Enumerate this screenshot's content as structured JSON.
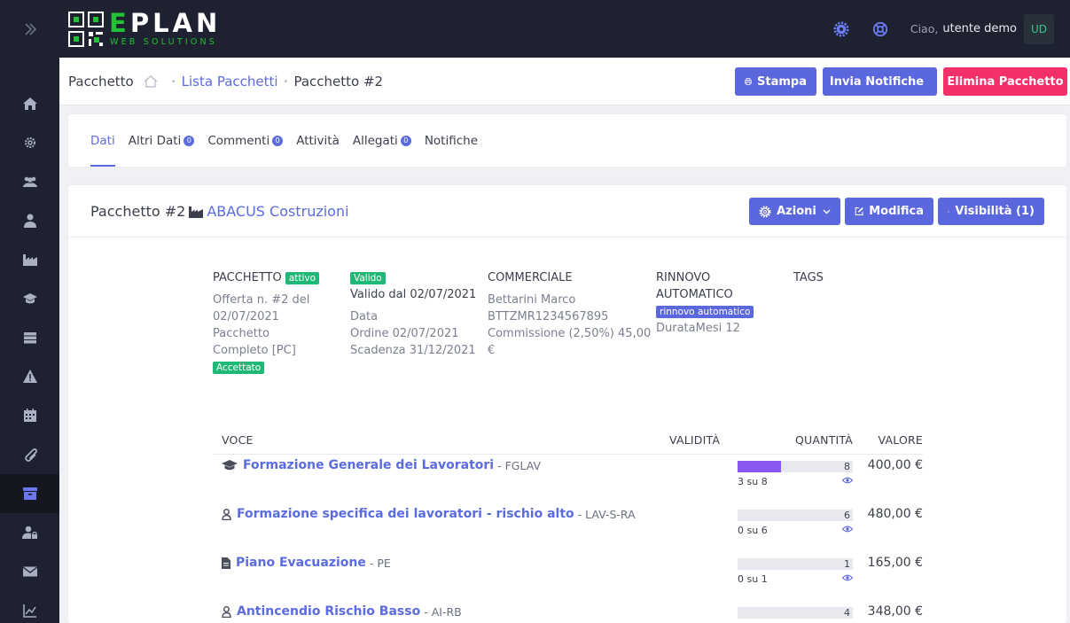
{
  "sidebar": {
    "toggle_icon": "double-chevron-right-icon",
    "items": [
      {
        "icon": "home-icon"
      },
      {
        "icon": "gear-icon"
      },
      {
        "icon": "users-icon"
      },
      {
        "icon": "user-tie-icon"
      },
      {
        "icon": "industry-icon"
      },
      {
        "icon": "graduation-cap-icon"
      },
      {
        "icon": "server-icon"
      },
      {
        "icon": "warning-icon"
      },
      {
        "icon": "calendar-icon"
      },
      {
        "icon": "paperclip-icon"
      },
      {
        "icon": "archive-icon",
        "active": true
      },
      {
        "icon": "user-lock-icon"
      },
      {
        "icon": "envelope-icon"
      },
      {
        "icon": "chart-icon"
      }
    ]
  },
  "topbar": {
    "logo_main": "EPLAN",
    "logo_sub": "WEB SOLUTIONS",
    "greeting": "Ciao,",
    "username": "utente demo",
    "avatar": "UD",
    "icons": [
      "settings-gear-icon",
      "support-lifebuoy-icon"
    ]
  },
  "header": {
    "title": "Pacchetto",
    "breadcrumb_link": "Lista Pacchetti",
    "breadcrumb_current": "Pacchetto #2",
    "btn_print": "Stampa",
    "btn_notify": "Invia Notifiche",
    "btn_delete": "Elimina Pacchetto"
  },
  "tabs": [
    {
      "label": "Dati",
      "active": true
    },
    {
      "label": "Altri Dati",
      "badge": "0"
    },
    {
      "label": "Commenti",
      "badge": "0"
    },
    {
      "label": "Attività"
    },
    {
      "label": "Allegati",
      "badge": "0"
    },
    {
      "label": "Notifiche"
    }
  ],
  "card": {
    "title": "Pacchetto #2",
    "company": "ABACUS Costruzioni",
    "btn_actions": "Azioni",
    "btn_edit": "Modifica",
    "btn_visibility": "Visibilità (1)"
  },
  "info": {
    "pacchetto": {
      "label": "PACCHETTO",
      "status": "attivo",
      "line1": "Offerta n. #2 del",
      "line2": "02/07/2021",
      "line3": "Pacchetto",
      "line4": "Completo [PC]",
      "badge": "Accettato"
    },
    "validita": {
      "badge": "Valido",
      "valid_from": "Valido dal 02/07/2021",
      "line1": "Data",
      "line2": "Ordine 02/07/2021",
      "line3": "Scadenza 31/12/2021"
    },
    "commerciale": {
      "label": "COMMERCIALE",
      "name": "Bettarini Marco",
      "code": "BTTZMR1234567895",
      "commission1": "Commissione (2,50%) 45,00",
      "commission2": "€"
    },
    "rinnovo": {
      "label1": "RINNOVO",
      "label2": "AUTOMATICO",
      "badge": "rinnovo automatico",
      "duration": "DurataMesi 12"
    },
    "tags": {
      "label": "TAGS"
    }
  },
  "table": {
    "headers": {
      "voce": "VOCE",
      "validita": "VALIDITÀ",
      "quantita": "QUANTITÀ",
      "valore": "VALORE"
    },
    "rows": [
      {
        "icon": "graduation-cap-icon",
        "name": "Formazione Generale dei Lavoratori",
        "code": "- FGLAV",
        "used": 3,
        "total": 8,
        "qty": "8",
        "usage": "3 su 8",
        "value": "400,00 €"
      },
      {
        "icon": "user-icon",
        "name": "Formazione specifica dei lavoratori - rischio alto",
        "code": "- LAV-S-RA",
        "used": 0,
        "total": 6,
        "qty": "6",
        "usage": "0 su 6",
        "value": "480,00 €"
      },
      {
        "icon": "file-icon",
        "name": "Piano Evacuazione",
        "code": "- PE",
        "used": 0,
        "total": 1,
        "qty": "1",
        "usage": "0 su 1",
        "value": "165,00 €"
      },
      {
        "icon": "user-icon",
        "name": "Antincendio Rischio Basso",
        "code": "- AI-RB",
        "used": 0,
        "total": 4,
        "qty": "4",
        "usage": "",
        "value": "348,00 €"
      }
    ]
  },
  "colors": {
    "primary": "#5b67dc",
    "danger": "#f3306a",
    "success": "#1fb876",
    "sidebar": "#1e2130",
    "progress": "#8b57f3"
  }
}
